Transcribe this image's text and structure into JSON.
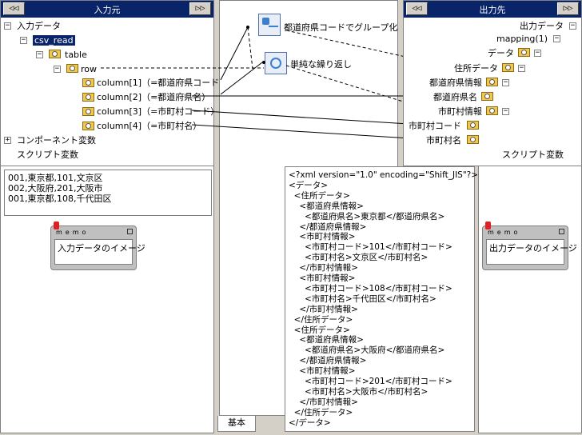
{
  "left_panel": {
    "title": "入力元",
    "prev_label": "◁◁",
    "next_label": "▷▷",
    "tree": {
      "root": "入力データ",
      "csv": "csv_read",
      "table": "table",
      "row": "row",
      "columns": [
        "column[1]（=都道府県コード）",
        "column[2]（=都道府県名）",
        "column[3]（=市町村コード）",
        "column[4]（=市町村名）"
      ],
      "component_vars": "コンポーネント変数",
      "script_vars": "スクリプト変数"
    },
    "sample_lines": [
      "001,東京都,101,文京区",
      "002,大阪府,201,大阪市",
      "001,東京都,108,千代田区"
    ],
    "memo": {
      "caption": "memo",
      "text": "入力データのイメージ"
    }
  },
  "center_panel": {
    "group_label": "都道府県コードでグループ化",
    "loop_label": "単純な繰り返し",
    "tab_label": "基本"
  },
  "right_panel": {
    "title": "出力先",
    "prev_label": "◁◁",
    "next_label": "▷▷",
    "tree": {
      "root": "出力データ",
      "mapping": "mapping(1)",
      "data": "データ",
      "address": "住所データ",
      "pref_info": "都道府県情報",
      "pref_name": "都道府県名",
      "city_info": "市町村情報",
      "city_code": "市町村コード",
      "city_name": "市町村名",
      "script_vars": "スクリプト変数"
    },
    "memo": {
      "caption": "memo",
      "text": "出力データのイメージ"
    }
  },
  "xml_preview": {
    "lines": [
      "<?xml version=\"1.0\" encoding=\"Shift_JIS\"?>",
      "<データ>",
      "  <住所データ>",
      "    <都道府県情報>",
      "      <都道府県名>東京都</都道府県名>",
      "    </都道府県情報>",
      "    <市町村情報>",
      "      <市町村コード>101</市町村コード>",
      "      <市町村名>文京区</市町村名>",
      "    </市町村情報>",
      "    <市町村情報>",
      "      <市町村コード>108</市町村コード>",
      "      <市町村名>千代田区</市町村名>",
      "    </市町村情報>",
      "  </住所データ>",
      "  <住所データ>",
      "    <都道府県情報>",
      "      <都道府県名>大阪府</都道府県名>",
      "    </都道府県情報>",
      "    <市町村情報>",
      "      <市町村コード>201</市町村コード>",
      "      <市町村名>大阪市</市町村名>",
      "    </市町村情報>",
      "  </住所データ>",
      "</データ>"
    ]
  }
}
